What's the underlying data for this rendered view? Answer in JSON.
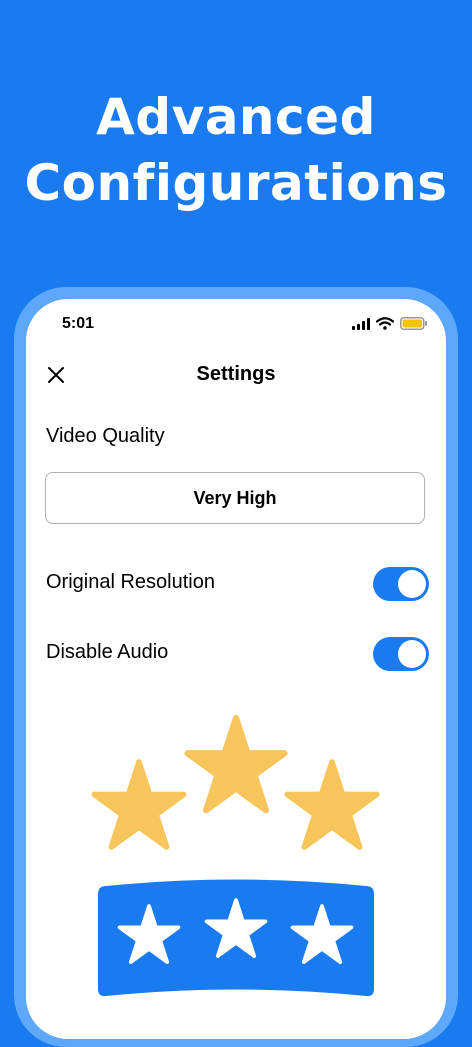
{
  "headline": {
    "line1": "Advanced",
    "line2": "Configurations"
  },
  "status_bar": {
    "time": "5:01",
    "icons": [
      "signal-icon",
      "wifi-icon",
      "battery-icon"
    ],
    "battery_color": "#f5c400"
  },
  "nav": {
    "title": "Settings",
    "close_icon": "close-icon"
  },
  "video_quality": {
    "label": "Video Quality",
    "selected": "Very High"
  },
  "options": [
    {
      "label": "Original Resolution",
      "enabled": true
    },
    {
      "label": "Disable Audio",
      "enabled": true
    }
  ],
  "illustration": {
    "rating_stars": 3,
    "banner_stars": 3
  },
  "colors": {
    "accent": "#1a7bf0",
    "frame": "#5ea8fb",
    "star": "#f7c55c"
  }
}
